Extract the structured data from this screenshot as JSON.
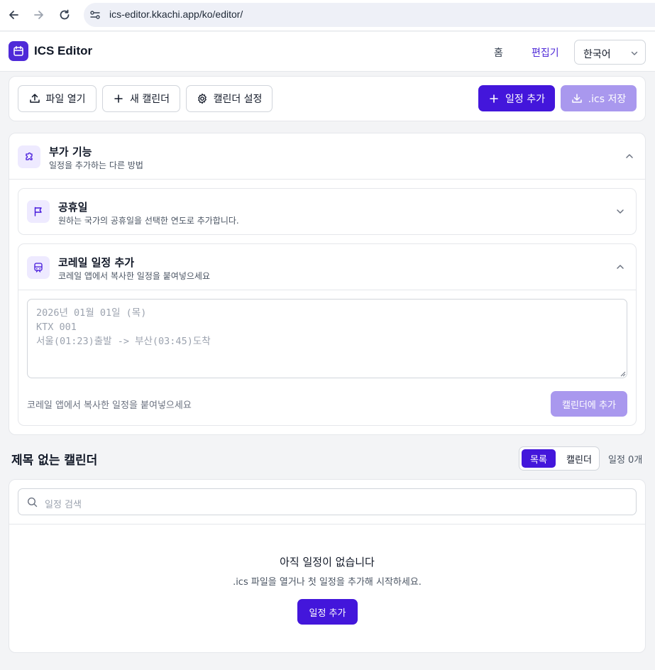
{
  "browser": {
    "url": "ics-editor.kkachi.app/ko/editor/",
    "icons": [
      "back-icon",
      "forward-icon",
      "reload-icon",
      "site-settings-icon"
    ]
  },
  "header": {
    "app_title": "ICS Editor",
    "nav_home": "홈",
    "nav_editor": "편집기",
    "language": "한국어"
  },
  "toolbar": {
    "open_file": "파일 열기",
    "new_calendar": "새 캘린더",
    "calendar_settings": "캘린더 설정",
    "add_event": "일정 추가",
    "save_ics": ".ics 저장"
  },
  "extras": {
    "title": "부가 기능",
    "subtitle": "일정을 추가하는 다른 방법",
    "holiday": {
      "title": "공휴일",
      "subtitle": "원하는 국가의 공휴일을 선택한 연도로 추가합니다."
    },
    "korail": {
      "title": "코레일 일정 추가",
      "subtitle": "코레일 앱에서 복사한 일정을 붙여넣으세요",
      "placeholder": "2026년 01월 01일 (목)\nKTX 001\n서울(01:23)출발 -> 부산(03:45)도착",
      "hint": "코레일 앱에서 복사한 일정을 붙여넣으세요",
      "add_button": "캘린더에 추가"
    }
  },
  "calendar": {
    "title": "제목 없는 캘린더",
    "view_list": "목록",
    "view_calendar": "캘린더",
    "event_count": "일정 0개",
    "search_placeholder": "일정 검색",
    "empty_title": "아직 일정이 없습니다",
    "empty_subtitle": ".ics 파일을 열거나 첫 일정을 추가해 시작하세요.",
    "empty_button": "일정 추가"
  },
  "colors": {
    "accent": "#4316db",
    "accent_disabled": "#a998ee",
    "accent_soft": "#eeeaff"
  }
}
